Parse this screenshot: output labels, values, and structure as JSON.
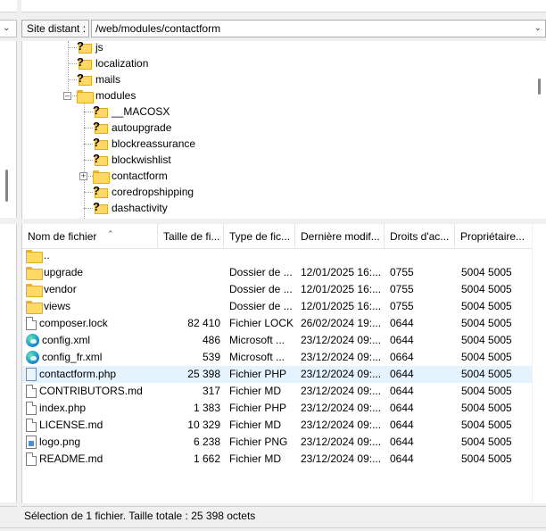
{
  "remote_site": {
    "label": "Site distant :",
    "path": "/web/modules/contactform"
  },
  "tree": {
    "items": [
      {
        "label": "js",
        "icon": "unknown-folder-icon"
      },
      {
        "label": "localization",
        "icon": "unknown-folder-icon"
      },
      {
        "label": "mails",
        "icon": "unknown-folder-icon"
      },
      {
        "label": "modules",
        "icon": "folder-icon",
        "expanded": true
      },
      {
        "label": "__MACOSX",
        "icon": "unknown-folder-icon"
      },
      {
        "label": "autoupgrade",
        "icon": "unknown-folder-icon"
      },
      {
        "label": "blockreassurance",
        "icon": "unknown-folder-icon"
      },
      {
        "label": "blockwishlist",
        "icon": "unknown-folder-icon"
      },
      {
        "label": "contactform",
        "icon": "folder-icon",
        "current": true
      },
      {
        "label": "coredropshipping",
        "icon": "unknown-folder-icon"
      },
      {
        "label": "dashactivity",
        "icon": "unknown-folder-icon"
      }
    ]
  },
  "list": {
    "columns": [
      "Nom de fichier",
      "Taille de fi...",
      "Type de fic...",
      "Dernière modif...",
      "Droits d'ac...",
      "Propriétaire..."
    ],
    "rows": [
      {
        "name": "..",
        "size": "",
        "type": "",
        "modified": "",
        "perms": "",
        "owner": "",
        "icon": "folder-icon"
      },
      {
        "name": "upgrade",
        "size": "",
        "type": "Dossier de ...",
        "modified": "12/01/2025 16:...",
        "perms": "0755",
        "owner": "5004 5005",
        "icon": "folder-icon"
      },
      {
        "name": "vendor",
        "size": "",
        "type": "Dossier de ...",
        "modified": "12/01/2025 16:...",
        "perms": "0755",
        "owner": "5004 5005",
        "icon": "folder-icon"
      },
      {
        "name": "views",
        "size": "",
        "type": "Dossier de ...",
        "modified": "12/01/2025 16:...",
        "perms": "0755",
        "owner": "5004 5005",
        "icon": "folder-icon"
      },
      {
        "name": "composer.lock",
        "size": "82 410",
        "type": "Fichier LOCK",
        "modified": "26/02/2024 19:...",
        "perms": "0644",
        "owner": "5004 5005",
        "icon": "file-icon"
      },
      {
        "name": "config.xml",
        "size": "486",
        "type": "Microsoft ...",
        "modified": "23/12/2024 09:...",
        "perms": "0644",
        "owner": "5004 5005",
        "icon": "edge-icon"
      },
      {
        "name": "config_fr.xml",
        "size": "539",
        "type": "Microsoft ...",
        "modified": "23/12/2024 09:...",
        "perms": "0664",
        "owner": "5004 5005",
        "icon": "edge-icon"
      },
      {
        "name": "contactform.php",
        "size": "25 398",
        "type": "Fichier PHP",
        "modified": "23/12/2024 09:...",
        "perms": "0644",
        "owner": "5004 5005",
        "icon": "php-file-icon",
        "selected": true
      },
      {
        "name": "CONTRIBUTORS.md",
        "size": "317",
        "type": "Fichier MD",
        "modified": "23/12/2024 09:...",
        "perms": "0644",
        "owner": "5004 5005",
        "icon": "file-icon"
      },
      {
        "name": "index.php",
        "size": "1 383",
        "type": "Fichier PHP",
        "modified": "23/12/2024 09:...",
        "perms": "0644",
        "owner": "5004 5005",
        "icon": "file-icon"
      },
      {
        "name": "LICENSE.md",
        "size": "10 329",
        "type": "Fichier MD",
        "modified": "23/12/2024 09:...",
        "perms": "0644",
        "owner": "5004 5005",
        "icon": "file-icon"
      },
      {
        "name": "logo.png",
        "size": "6 238",
        "type": "Fichier PNG",
        "modified": "23/12/2024 09:...",
        "perms": "0644",
        "owner": "5004 5005",
        "icon": "png-file-icon"
      },
      {
        "name": "README.md",
        "size": "1 662",
        "type": "Fichier MD",
        "modified": "23/12/2024 09:...",
        "perms": "0644",
        "owner": "5004 5005",
        "icon": "file-icon"
      }
    ]
  },
  "status": {
    "text": "Sélection de 1 fichier. Taille totale : 25 398 octets"
  },
  "colors": {
    "selected_row": "#e5f3ff",
    "folder": "#ffd865"
  }
}
